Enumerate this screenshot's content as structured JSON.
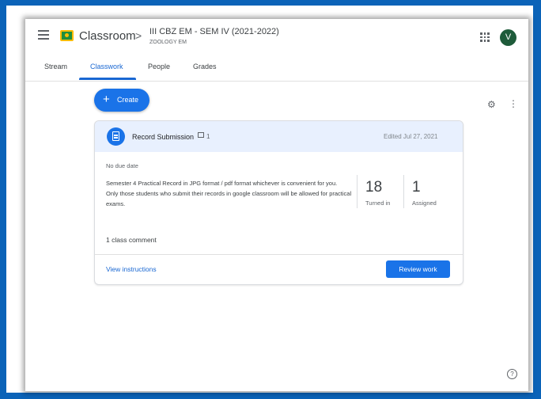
{
  "header": {
    "app_name": "Classroom",
    "chevron": ">",
    "class_title": "III CBZ EM - SEM IV (2021-2022)",
    "class_subtitle": "ZOOLOGY EM",
    "avatar_letter": "V"
  },
  "tabs": [
    {
      "label": "Stream",
      "active": false
    },
    {
      "label": "Classwork",
      "active": true
    },
    {
      "label": "People",
      "active": false
    },
    {
      "label": "Grades",
      "active": false
    }
  ],
  "create_button": {
    "icon": "+",
    "label": "Create"
  },
  "assignment": {
    "title": "Record Submission",
    "comment_count": "1",
    "edited": "Edited Jul 27, 2021",
    "due": "No due date",
    "description_line1": "Semester 4 Practical Record in JPG format / pdf format whichever is convenient for you.",
    "description_line2": "Only those students who submit their records in google classroom will be allowed for practical exams.",
    "turned_in_count": "18",
    "turned_in_label": "Turned in",
    "assigned_count": "1",
    "assigned_label": "Assigned",
    "class_comment": "1 class comment",
    "view_instructions": "View instructions",
    "review_button": "Review work"
  },
  "help_icon": "?",
  "colors": {
    "accent": "#1a73e8",
    "border_blue": "#0b63b8",
    "avatar": "#1e5b3a"
  }
}
